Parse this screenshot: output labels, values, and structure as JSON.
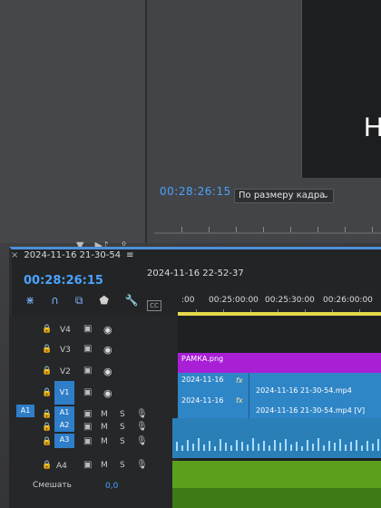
{
  "program_monitor": {
    "timecode": "00:28:26:15",
    "fit_select": "По размеру кадра",
    "frame_text": "Н"
  },
  "timeline": {
    "sequence_tab": "2024-11-16 21-30-54",
    "other_sequence": "2024-11-16 22-52-37",
    "timecode": "00:28:26:15",
    "ruler": [
      ":00",
      "00:25:00:00",
      "00:25:30:00",
      "00:26:00:00"
    ],
    "tracks": [
      {
        "name": "V4",
        "type": "video"
      },
      {
        "name": "V3",
        "type": "video"
      },
      {
        "name": "V2",
        "type": "video"
      },
      {
        "name": "V1",
        "type": "video"
      },
      {
        "name": "A1",
        "type": "audio"
      },
      {
        "name": "A2",
        "type": "audio"
      },
      {
        "name": "A3",
        "type": "audio"
      },
      {
        "name": "A4",
        "type": "audio"
      }
    ],
    "source_patch": "A1",
    "clips": {
      "graphic": "РАМКА.png",
      "v1_short": "2024-11-16",
      "v1_long": "2024-11-16 21-30-54.mp4",
      "a1_short": "2024-11-16",
      "a1_long": "2024-11-16 21-30-54.mp4 [V]"
    },
    "mix_label": "Смешать",
    "mix_value": "0,0"
  }
}
